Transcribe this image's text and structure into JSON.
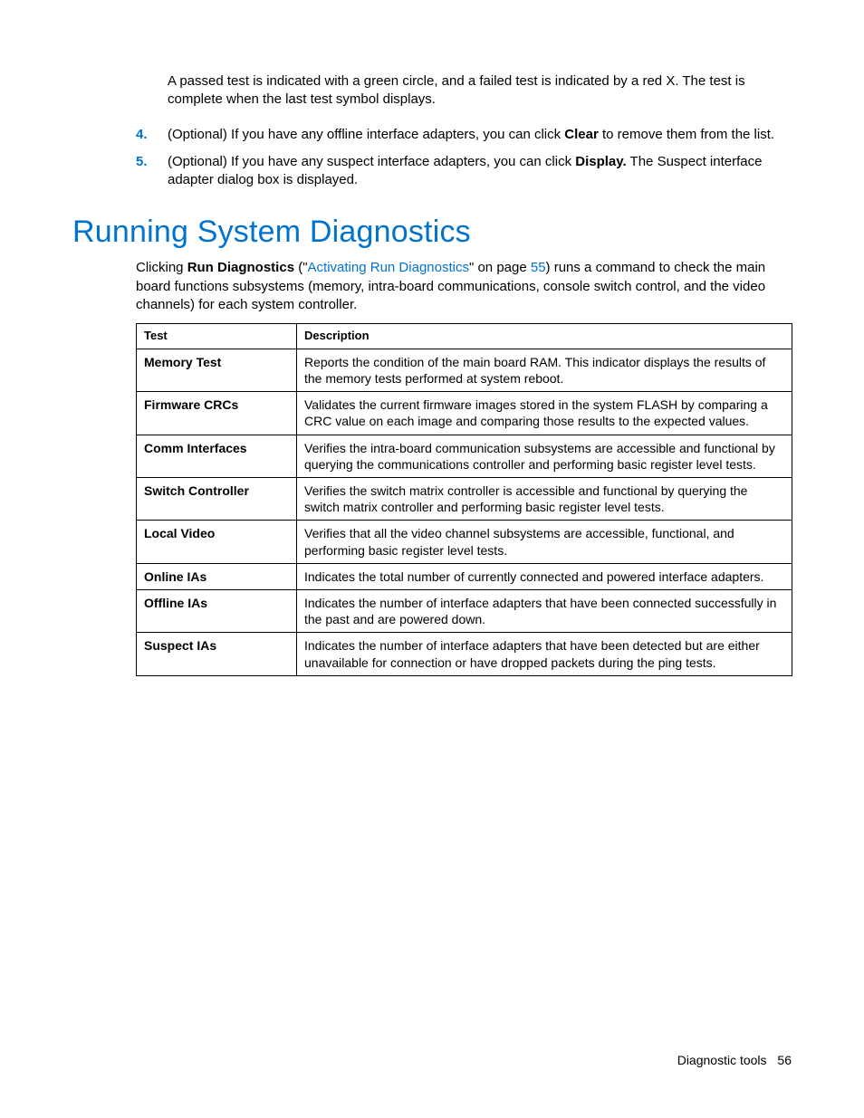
{
  "intro": {
    "paragraph": "A passed test is indicated with a green circle, and a failed test is indicated by a red X. The test is complete when the last test symbol displays."
  },
  "list": {
    "items": [
      {
        "marker": "4.",
        "before": "(Optional) If you have any offline interface adapters, you can click ",
        "bold": "Clear",
        "after": " to remove them from the list."
      },
      {
        "marker": "5.",
        "before": "(Optional) If you have any suspect interface adapters, you can click ",
        "bold": "Display.",
        "after": " The Suspect interface adapter dialog box is displayed."
      }
    ]
  },
  "heading": "Running System Diagnostics",
  "section": {
    "pre": "Clicking ",
    "bold": "Run Diagnostics",
    "paren_open": " (\"",
    "link_text": "Activating Run Diagnostics",
    "mid": "\" on page ",
    "link_page": "55",
    "post": ") runs a command to check the main board functions subsystems (memory, intra-board communications, console switch control, and the video channels) for each system controller."
  },
  "table": {
    "headers": {
      "c1": "Test",
      "c2": "Description"
    },
    "rows": [
      {
        "c1": "Memory Test",
        "c2": "Reports the condition of the main board RAM. This indicator displays the results of the memory tests performed at system reboot."
      },
      {
        "c1": "Firmware CRCs",
        "c2": "Validates the current firmware images stored in the system FLASH by comparing a CRC value on each image and comparing those results to the expected values."
      },
      {
        "c1": "Comm Interfaces",
        "c2": "Verifies the intra-board communication subsystems are accessible and functional by querying the communications controller and performing basic register level tests."
      },
      {
        "c1": "Switch Controller",
        "c2": "Verifies the switch matrix controller is accessible and functional by querying the switch matrix controller and performing basic register level tests."
      },
      {
        "c1": "Local Video",
        "c2": "Verifies that all the video channel subsystems are accessible, functional, and performing basic register level tests."
      },
      {
        "c1": "Online IAs",
        "c2": "Indicates the total number of currently connected and powered interface adapters."
      },
      {
        "c1": "Offline IAs",
        "c2": "Indicates the number of interface adapters that have been connected successfully in the past and are powered down."
      },
      {
        "c1": "Suspect IAs",
        "c2": "Indicates the number of interface adapters that have been detected but are either unavailable for connection or have dropped packets during the ping tests."
      }
    ]
  },
  "footer": {
    "section": "Diagnostic tools",
    "page": "56"
  }
}
